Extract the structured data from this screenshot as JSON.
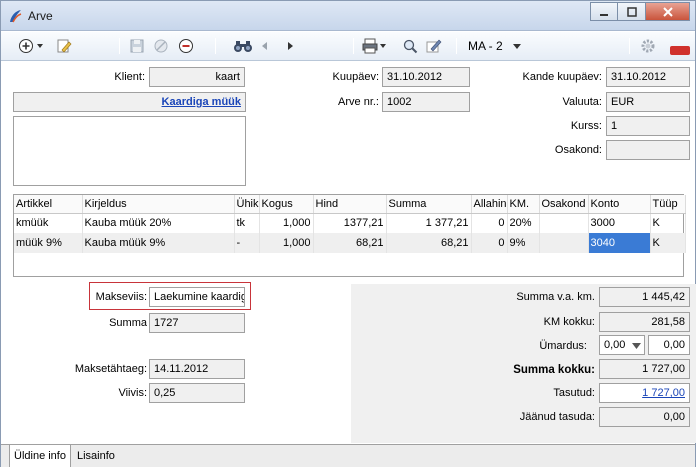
{
  "window": {
    "title": "Arve",
    "min_icon": "minimize-icon",
    "max_icon": "maximize-icon",
    "close_icon": "close-icon"
  },
  "toolbar": {
    "dimension": "MA - 2"
  },
  "header": {
    "klient_label": "Klient:",
    "klient_value": "kaart",
    "customer_name": "Kaardiga müük",
    "kuupaev_label": "Kuupäev:",
    "kuupaev_value": "31.10.2012",
    "arve_nr_label": "Arve nr.:",
    "arve_nr_value": "1002",
    "kande_label": "Kande kuupäev:",
    "kande_value": "31.10.2012",
    "valuuta_label": "Valuuta:",
    "valuuta_value": "EUR",
    "kurss_label": "Kurss:",
    "kurss_value": "1",
    "osakond_label": "Osakond:",
    "osakond_value": ""
  },
  "grid": {
    "columns": [
      "Artikkel",
      "Kirjeldus",
      "Ühik",
      "Kogus",
      "Hind",
      "Summa",
      "Allahindlus",
      "KM.",
      "Osakond",
      "Konto",
      "Tüüp"
    ],
    "rows": [
      [
        "kmüük",
        "Kauba müük  20%",
        "tk",
        "1,000",
        "1377,21",
        "1 377,21",
        "0",
        "20%",
        "",
        "3000",
        "K"
      ],
      [
        "müük 9%",
        "Kauba müük 9%",
        "-",
        "1,000",
        "68,21",
        "68,21",
        "0",
        "9%",
        "",
        "3040",
        "K"
      ]
    ]
  },
  "payment": {
    "makseviis_label": "Makseviis:",
    "makseviis_value": "Laekumine kaardiga",
    "summa_label": "Summa",
    "summa_value": "1727",
    "maksetahtaeg_label": "Maksetähtaeg:",
    "maksetahtaeg_value": "14.11.2012",
    "viivis_label": "Viivis:",
    "viivis_value": "0,25"
  },
  "totals": {
    "summa_vaa_label": "Summa v.a. km.",
    "summa_vaa_value": "1 445,42",
    "km_label": "KM kokku:",
    "km_value": "281,58",
    "umardus_label": "Ümardus:",
    "umardus_value": "0,00",
    "umardus_select": "0,00",
    "kokku_label": "Summa kokku:",
    "kokku_value": "1 727,00",
    "tasutud_label": "Tasutud:",
    "tasutud_value": "1 727,00",
    "jaanud_label": "Jäänud tasuda:",
    "jaanud_value": "0,00"
  },
  "tabs": [
    {
      "label": "Üldine info"
    },
    {
      "label": "Lisainfo"
    }
  ]
}
